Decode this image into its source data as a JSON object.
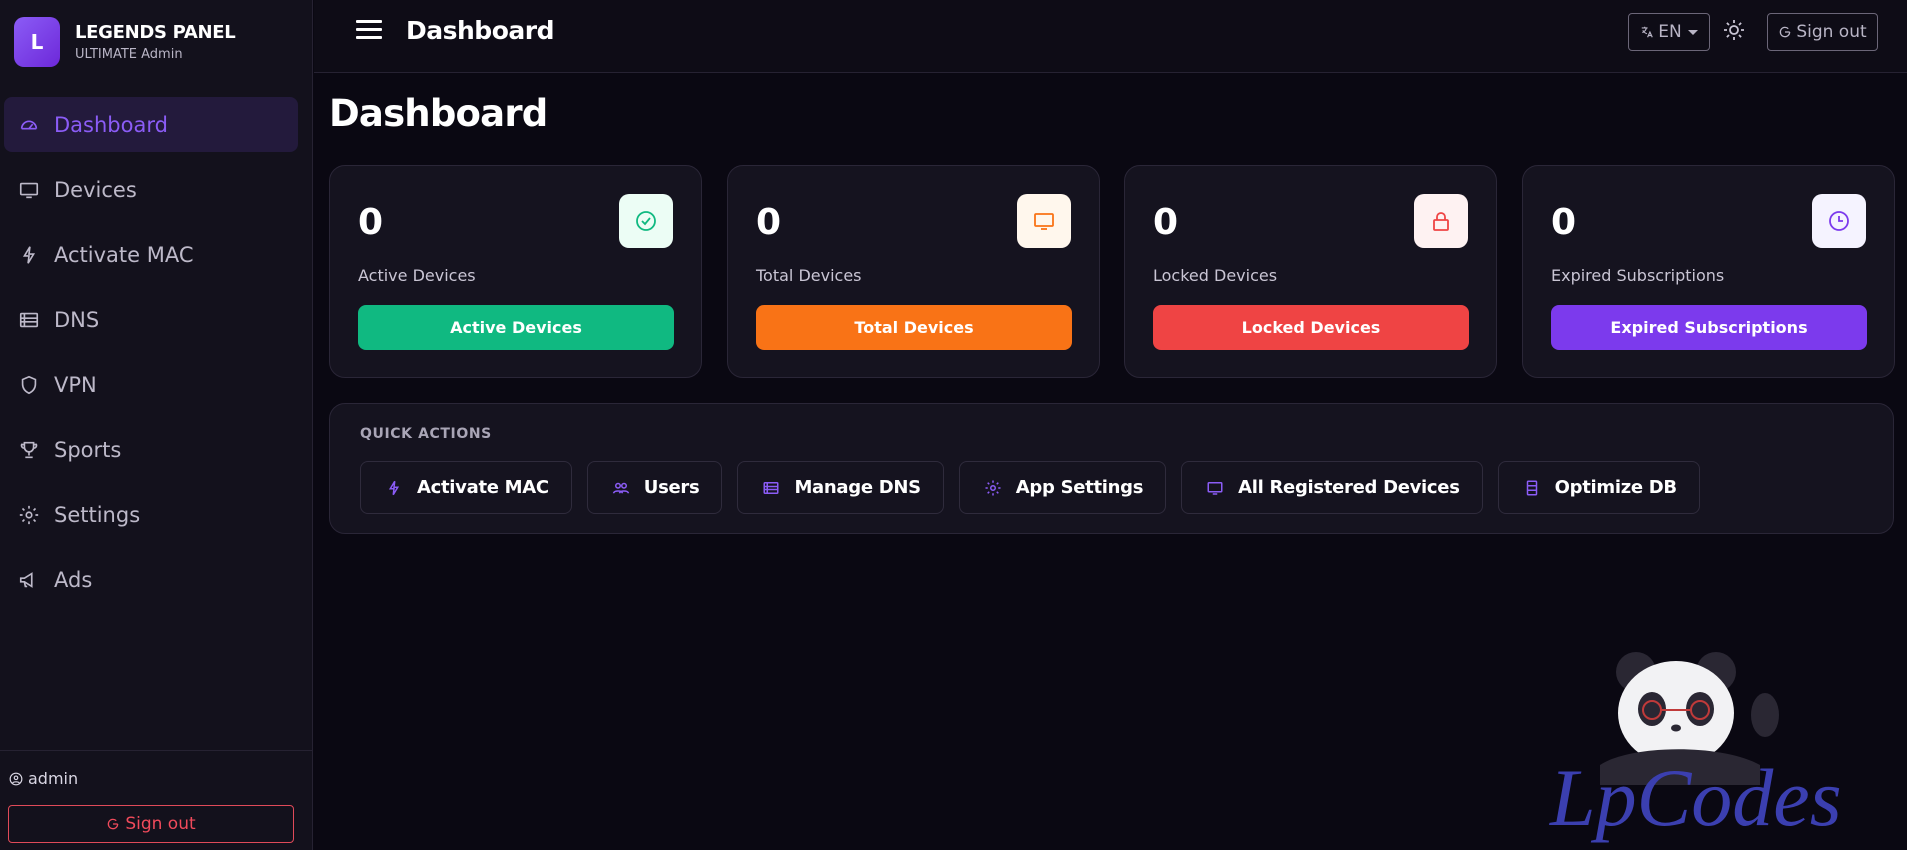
{
  "brand": {
    "logo_letter": "L",
    "title": "LEGENDS PANEL",
    "subtitle": "ULTIMATE Admin"
  },
  "sidebar": {
    "items": [
      {
        "label": "Dashboard",
        "icon": "gauge-icon",
        "active": true
      },
      {
        "label": "Devices",
        "icon": "monitor-icon"
      },
      {
        "label": "Activate MAC",
        "icon": "lightning-icon"
      },
      {
        "label": "DNS",
        "icon": "server-list-icon"
      },
      {
        "label": "VPN",
        "icon": "shield-icon"
      },
      {
        "label": "Sports",
        "icon": "trophy-icon"
      },
      {
        "label": "Settings",
        "icon": "gear-icon"
      },
      {
        "label": "Ads",
        "icon": "megaphone-icon"
      }
    ],
    "user": "admin",
    "signout_label": "Sign out"
  },
  "topbar": {
    "title": "Dashboard",
    "language": "EN",
    "signout_label": "Sign out"
  },
  "page": {
    "title": "Dashboard"
  },
  "cards": [
    {
      "value": "0",
      "label": "Active Devices",
      "button": "Active Devices",
      "color": "#10b981",
      "icon_bg": "#ecfdf5",
      "icon_color": "#10b981",
      "icon": "check-circle-icon"
    },
    {
      "value": "0",
      "label": "Total Devices",
      "button": "Total Devices",
      "color": "#f97316",
      "icon_bg": "#fff7ed",
      "icon_color": "#f97316",
      "icon": "monitor-icon"
    },
    {
      "value": "0",
      "label": "Locked Devices",
      "button": "Locked Devices",
      "color": "#ef4444",
      "icon_bg": "#fef2f2",
      "icon_color": "#ef4444",
      "icon": "lock-icon"
    },
    {
      "value": "0",
      "label": "Expired Subscriptions",
      "button": "Expired Subscriptions",
      "color": "#7c3aed",
      "icon_bg": "#f5f3ff",
      "icon_color": "#7c3aed",
      "icon": "clock-icon"
    }
  ],
  "quick_actions": {
    "title": "QUICK ACTIONS",
    "items": [
      {
        "label": "Activate MAC",
        "icon": "lightning-icon"
      },
      {
        "label": "Users",
        "icon": "users-icon"
      },
      {
        "label": "Manage DNS",
        "icon": "server-list-icon"
      },
      {
        "label": "App Settings",
        "icon": "gear-icon"
      },
      {
        "label": "All Registered Devices",
        "icon": "monitor-icon"
      },
      {
        "label": "Optimize DB",
        "icon": "database-icon"
      }
    ]
  },
  "watermark": {
    "text": "LpCodes"
  },
  "colors": {
    "accent": "#8b5cf6",
    "danger": "#ef4444",
    "background": "#0a0812",
    "sidebar": "#13111c"
  }
}
